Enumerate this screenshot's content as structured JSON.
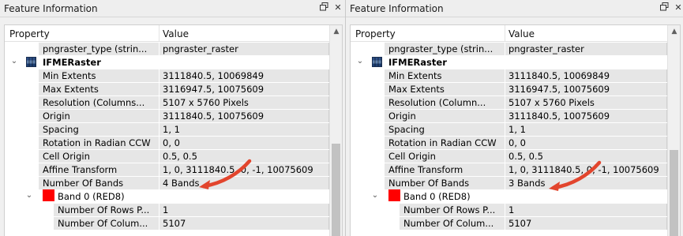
{
  "accent_color": "#e2452d",
  "panels": [
    {
      "title": "Feature Information",
      "controls": {
        "restore_icon": "restore-icon",
        "close_icon": "close-icon"
      },
      "headers": {
        "property": "Property",
        "value": "Value"
      },
      "rows": [
        {
          "property": "pngraster_type (strin...",
          "value": "pngraster_raster"
        },
        {
          "property": "IFMERaster",
          "value": ""
        },
        {
          "property": "Min Extents",
          "value": "3111840.5, 10069849"
        },
        {
          "property": "Max Extents",
          "value": "3116947.5, 10075609"
        },
        {
          "property": "Resolution (Columns...",
          "value": "5107 x 5760 Pixels"
        },
        {
          "property": "Origin",
          "value": "3111840.5, 10075609"
        },
        {
          "property": "Spacing",
          "value": "1, 1"
        },
        {
          "property": "Rotation in Radian CCW",
          "value": "0, 0"
        },
        {
          "property": "Cell Origin",
          "value": "0.5, 0.5"
        },
        {
          "property": "Affine Transform",
          "value": "1, 0, 3111840.5, 0, -1, 10075609"
        },
        {
          "property": "Number Of Bands",
          "value": "4 Bands"
        },
        {
          "property": "Band 0 (RED8)",
          "value": ""
        },
        {
          "property": "Number Of Rows P...",
          "value": "1"
        },
        {
          "property": "Number Of Colum...",
          "value": "5107"
        }
      ]
    },
    {
      "title": "Feature Information",
      "controls": {
        "restore_icon": "restore-icon",
        "close_icon": "close-icon"
      },
      "headers": {
        "property": "Property",
        "value": "Value"
      },
      "rows": [
        {
          "property": "pngraster_type (strin...",
          "value": "pngraster_raster"
        },
        {
          "property": "IFMERaster",
          "value": ""
        },
        {
          "property": "Min Extents",
          "value": "3111840.5, 10069849"
        },
        {
          "property": "Max Extents",
          "value": "3116947.5, 10075609"
        },
        {
          "property": "Resolution (Column...",
          "value": "5107 x 5760 Pixels"
        },
        {
          "property": "Origin",
          "value": "3111840.5, 10075609"
        },
        {
          "property": "Spacing",
          "value": "1, 1"
        },
        {
          "property": "Rotation in Radian CCW",
          "value": "0, 0"
        },
        {
          "property": "Cell Origin",
          "value": "0.5, 0.5"
        },
        {
          "property": "Affine Transform",
          "value": "1, 0, 3111840.5, 0, -1, 10075609"
        },
        {
          "property": "Number Of Bands",
          "value": "3 Bands"
        },
        {
          "property": "Band 0 (RED8)",
          "value": ""
        },
        {
          "property": "Number Of Rows P...",
          "value": "1"
        },
        {
          "property": "Number Of Colum...",
          "value": "5107"
        }
      ]
    }
  ]
}
